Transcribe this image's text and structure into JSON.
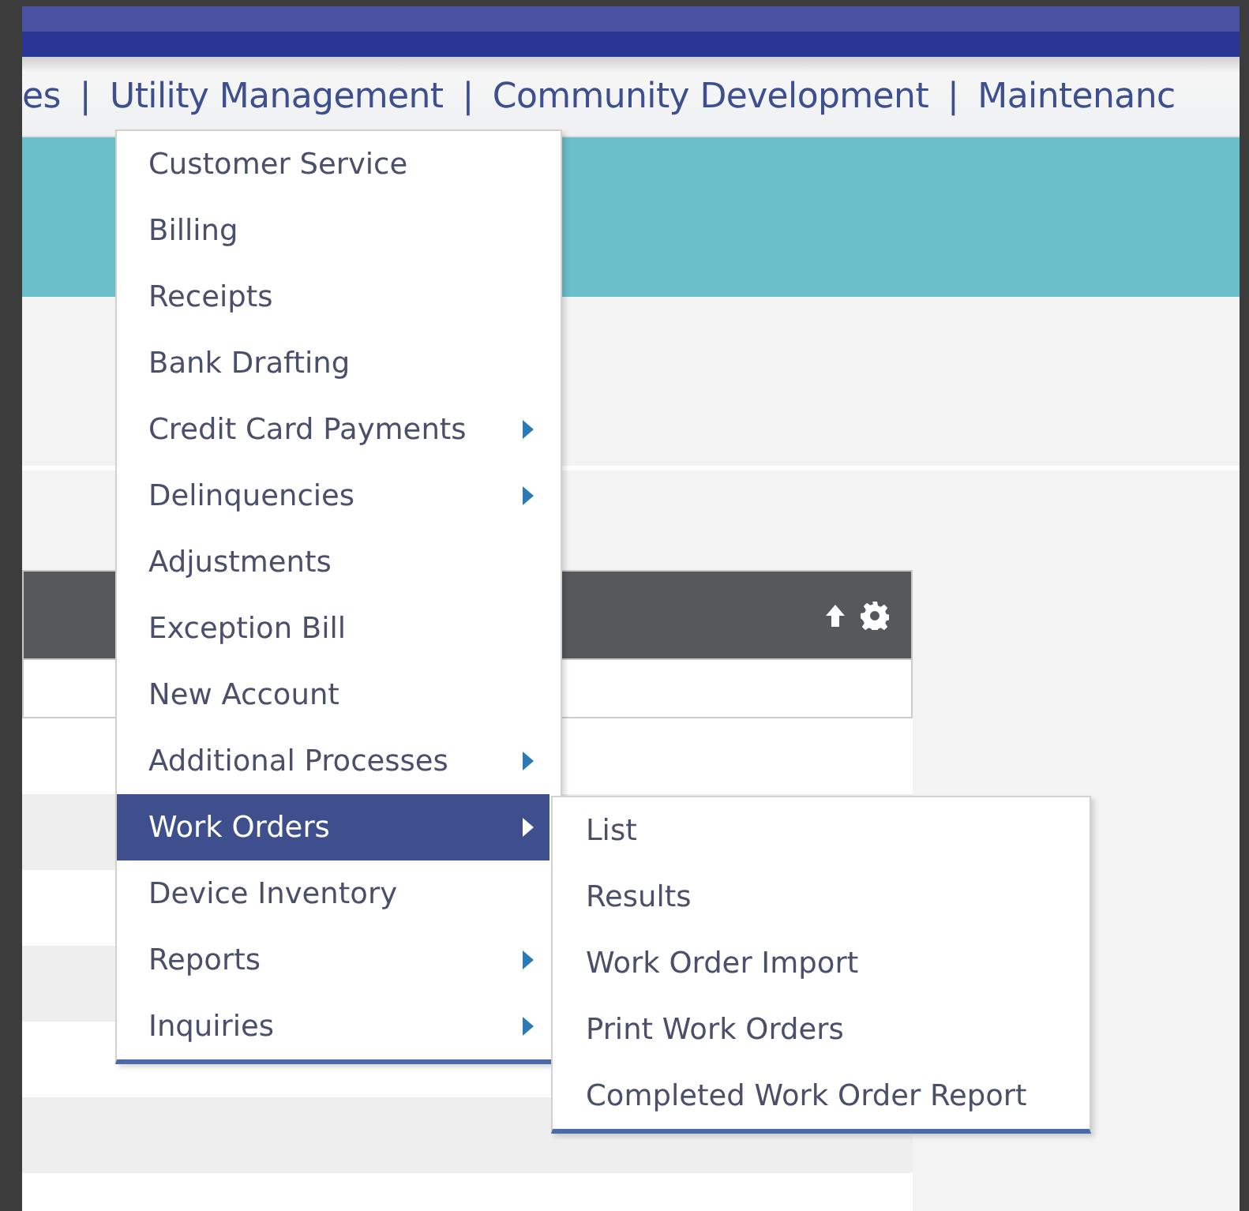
{
  "nav": {
    "separator": "|",
    "items": [
      {
        "label": "es"
      },
      {
        "label": "Utility Management"
      },
      {
        "label": "Community Development"
      },
      {
        "label": "Maintenanc"
      }
    ]
  },
  "menu": {
    "items": [
      {
        "label": "Customer Service",
        "has_submenu": false,
        "selected": false
      },
      {
        "label": "Billing",
        "has_submenu": false,
        "selected": false
      },
      {
        "label": "Receipts",
        "has_submenu": false,
        "selected": false
      },
      {
        "label": "Bank Drafting",
        "has_submenu": false,
        "selected": false
      },
      {
        "label": "Credit Card Payments",
        "has_submenu": true,
        "selected": false
      },
      {
        "label": "Delinquencies",
        "has_submenu": true,
        "selected": false
      },
      {
        "label": "Adjustments",
        "has_submenu": false,
        "selected": false
      },
      {
        "label": "Exception Bill",
        "has_submenu": false,
        "selected": false
      },
      {
        "label": "New Account",
        "has_submenu": false,
        "selected": false
      },
      {
        "label": "Additional Processes",
        "has_submenu": true,
        "selected": false
      },
      {
        "label": "Work Orders",
        "has_submenu": true,
        "selected": true
      },
      {
        "label": "Device Inventory",
        "has_submenu": false,
        "selected": false
      },
      {
        "label": "Reports",
        "has_submenu": true,
        "selected": false
      },
      {
        "label": "Inquiries",
        "has_submenu": true,
        "selected": false
      }
    ]
  },
  "submenu": {
    "items": [
      {
        "label": "List"
      },
      {
        "label": "Results"
      },
      {
        "label": "Work Order Import"
      },
      {
        "label": "Print Work Orders"
      },
      {
        "label": "Completed Work Order Report"
      }
    ]
  }
}
